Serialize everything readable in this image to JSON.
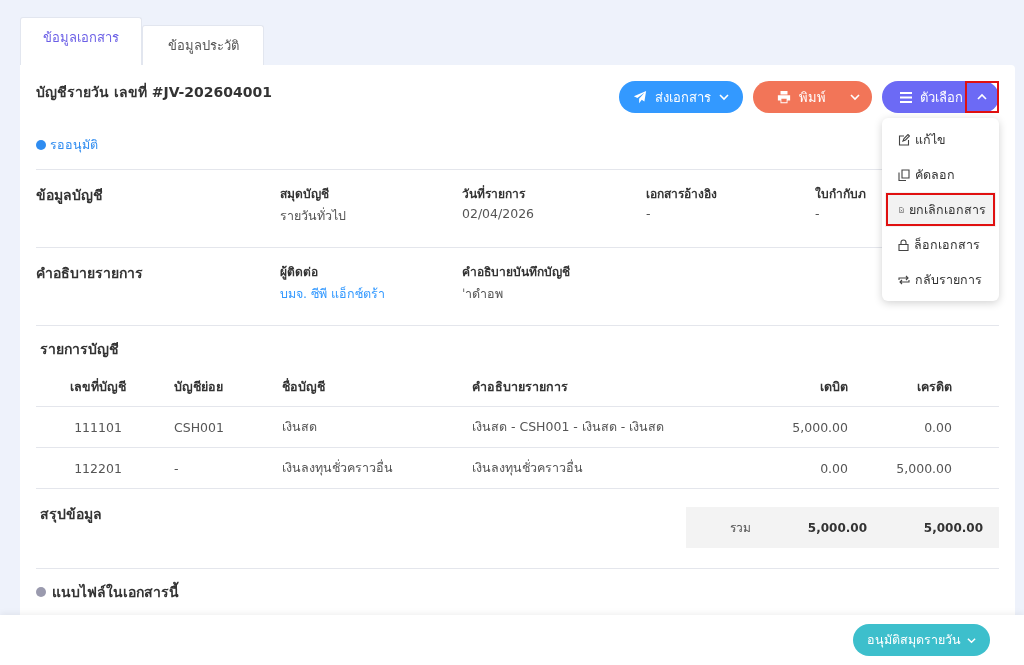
{
  "tabs": [
    {
      "label": "ข้อมูลเอกสาร",
      "selected": true
    },
    {
      "label": "ข้อมูลประวัติ",
      "selected": false
    }
  ],
  "document": {
    "title": "บัญชีรายวัน เลขที่ #JV-202604001",
    "status": {
      "label": "รออนุมัติ",
      "color": "#2f8cf0"
    }
  },
  "actions": [
    {
      "kind": "send",
      "label": "ส่งเอกสาร"
    },
    {
      "kind": "print",
      "label": "พิมพ์"
    },
    {
      "kind": "options",
      "label": "ตัวเลือก",
      "expanded": true,
      "highlighted": true
    }
  ],
  "options_menu": [
    {
      "label": "แก้ไข",
      "highlighted": false
    },
    {
      "label": "คัดลอก",
      "highlighted": false
    },
    {
      "label": "ยกเลิกเอกสาร",
      "highlighted": true
    },
    {
      "label": "ล็อกเอกสาร",
      "highlighted": false
    },
    {
      "label": "กลับรายการ",
      "highlighted": false
    }
  ],
  "sections": [
    {
      "heading": "ข้อมูลบัญชี",
      "fields": [
        {
          "label": "สมุดบัญชี",
          "value": "รายวันทั่วไป",
          "link": false
        },
        {
          "label": "วันที่รายการ",
          "value": "02/04/2026",
          "link": false
        },
        {
          "label": "เอกสารอ้างอิง",
          "value": "-",
          "link": false
        },
        {
          "label": "ใบกำกับภ",
          "value": "-",
          "link": false
        }
      ]
    },
    {
      "heading": "คำอธิบายรายการ",
      "fields": [
        {
          "label": "ผู้ติดต่อ",
          "value": "บมจ. ซีพี แอ็กซ์ตร้า",
          "link": true
        },
        {
          "label": "คำอธิบายบันทึกบัญชี",
          "value": "ˈาดำอพ",
          "link": false
        }
      ]
    }
  ],
  "table": {
    "title": "รายการบัญชี",
    "columns": [
      "เลขที่บัญชี",
      "บัญชีย่อย",
      "ชื่อบัญชี",
      "คำอธิบายรายการ",
      "เดบิต",
      "เครดิต"
    ],
    "rows": [
      [
        "111101",
        "CSH001",
        "เงินสด",
        "เงินสด - CSH001 - เงินสด - เงินสด",
        "5,000.00",
        "0.00"
      ],
      [
        "112201",
        "-",
        "เงินลงทุนชั่วคราวอื่น",
        "เงินลงทุนชั่วคราวอื่น",
        "0.00",
        "5,000.00"
      ]
    ]
  },
  "summary": {
    "heading": "สรุปข้อมูล",
    "total_label": "รวม",
    "debit": "5,000.00",
    "credit": "5,000.00"
  },
  "attachments": {
    "heading": "แนบไฟล์ในเอกสารนี้"
  },
  "footer": {
    "approve_button": "อนุมัติสมุดรายวัน"
  }
}
